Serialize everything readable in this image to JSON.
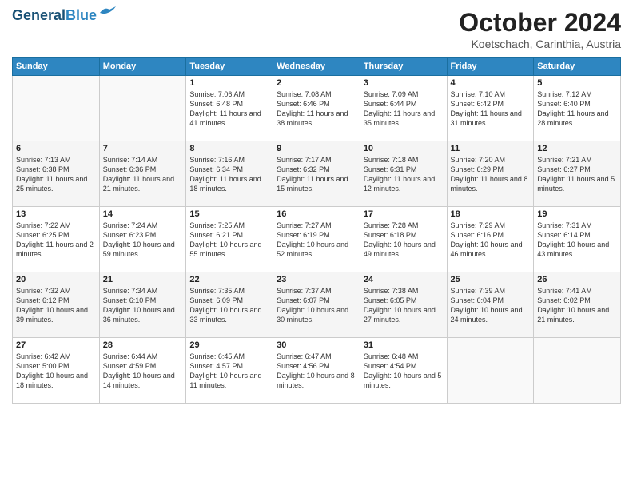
{
  "header": {
    "logo_line1": "General",
    "logo_line2": "Blue",
    "month_title": "October 2024",
    "location": "Koetschach, Carinthia, Austria"
  },
  "weekdays": [
    "Sunday",
    "Monday",
    "Tuesday",
    "Wednesday",
    "Thursday",
    "Friday",
    "Saturday"
  ],
  "weeks": [
    [
      {
        "day": "",
        "info": ""
      },
      {
        "day": "",
        "info": ""
      },
      {
        "day": "1",
        "info": "Sunrise: 7:06 AM\nSunset: 6:48 PM\nDaylight: 11 hours and 41 minutes."
      },
      {
        "day": "2",
        "info": "Sunrise: 7:08 AM\nSunset: 6:46 PM\nDaylight: 11 hours and 38 minutes."
      },
      {
        "day": "3",
        "info": "Sunrise: 7:09 AM\nSunset: 6:44 PM\nDaylight: 11 hours and 35 minutes."
      },
      {
        "day": "4",
        "info": "Sunrise: 7:10 AM\nSunset: 6:42 PM\nDaylight: 11 hours and 31 minutes."
      },
      {
        "day": "5",
        "info": "Sunrise: 7:12 AM\nSunset: 6:40 PM\nDaylight: 11 hours and 28 minutes."
      }
    ],
    [
      {
        "day": "6",
        "info": "Sunrise: 7:13 AM\nSunset: 6:38 PM\nDaylight: 11 hours and 25 minutes."
      },
      {
        "day": "7",
        "info": "Sunrise: 7:14 AM\nSunset: 6:36 PM\nDaylight: 11 hours and 21 minutes."
      },
      {
        "day": "8",
        "info": "Sunrise: 7:16 AM\nSunset: 6:34 PM\nDaylight: 11 hours and 18 minutes."
      },
      {
        "day": "9",
        "info": "Sunrise: 7:17 AM\nSunset: 6:32 PM\nDaylight: 11 hours and 15 minutes."
      },
      {
        "day": "10",
        "info": "Sunrise: 7:18 AM\nSunset: 6:31 PM\nDaylight: 11 hours and 12 minutes."
      },
      {
        "day": "11",
        "info": "Sunrise: 7:20 AM\nSunset: 6:29 PM\nDaylight: 11 hours and 8 minutes."
      },
      {
        "day": "12",
        "info": "Sunrise: 7:21 AM\nSunset: 6:27 PM\nDaylight: 11 hours and 5 minutes."
      }
    ],
    [
      {
        "day": "13",
        "info": "Sunrise: 7:22 AM\nSunset: 6:25 PM\nDaylight: 11 hours and 2 minutes."
      },
      {
        "day": "14",
        "info": "Sunrise: 7:24 AM\nSunset: 6:23 PM\nDaylight: 10 hours and 59 minutes."
      },
      {
        "day": "15",
        "info": "Sunrise: 7:25 AM\nSunset: 6:21 PM\nDaylight: 10 hours and 55 minutes."
      },
      {
        "day": "16",
        "info": "Sunrise: 7:27 AM\nSunset: 6:19 PM\nDaylight: 10 hours and 52 minutes."
      },
      {
        "day": "17",
        "info": "Sunrise: 7:28 AM\nSunset: 6:18 PM\nDaylight: 10 hours and 49 minutes."
      },
      {
        "day": "18",
        "info": "Sunrise: 7:29 AM\nSunset: 6:16 PM\nDaylight: 10 hours and 46 minutes."
      },
      {
        "day": "19",
        "info": "Sunrise: 7:31 AM\nSunset: 6:14 PM\nDaylight: 10 hours and 43 minutes."
      }
    ],
    [
      {
        "day": "20",
        "info": "Sunrise: 7:32 AM\nSunset: 6:12 PM\nDaylight: 10 hours and 39 minutes."
      },
      {
        "day": "21",
        "info": "Sunrise: 7:34 AM\nSunset: 6:10 PM\nDaylight: 10 hours and 36 minutes."
      },
      {
        "day": "22",
        "info": "Sunrise: 7:35 AM\nSunset: 6:09 PM\nDaylight: 10 hours and 33 minutes."
      },
      {
        "day": "23",
        "info": "Sunrise: 7:37 AM\nSunset: 6:07 PM\nDaylight: 10 hours and 30 minutes."
      },
      {
        "day": "24",
        "info": "Sunrise: 7:38 AM\nSunset: 6:05 PM\nDaylight: 10 hours and 27 minutes."
      },
      {
        "day": "25",
        "info": "Sunrise: 7:39 AM\nSunset: 6:04 PM\nDaylight: 10 hours and 24 minutes."
      },
      {
        "day": "26",
        "info": "Sunrise: 7:41 AM\nSunset: 6:02 PM\nDaylight: 10 hours and 21 minutes."
      }
    ],
    [
      {
        "day": "27",
        "info": "Sunrise: 6:42 AM\nSunset: 5:00 PM\nDaylight: 10 hours and 18 minutes."
      },
      {
        "day": "28",
        "info": "Sunrise: 6:44 AM\nSunset: 4:59 PM\nDaylight: 10 hours and 14 minutes."
      },
      {
        "day": "29",
        "info": "Sunrise: 6:45 AM\nSunset: 4:57 PM\nDaylight: 10 hours and 11 minutes."
      },
      {
        "day": "30",
        "info": "Sunrise: 6:47 AM\nSunset: 4:56 PM\nDaylight: 10 hours and 8 minutes."
      },
      {
        "day": "31",
        "info": "Sunrise: 6:48 AM\nSunset: 4:54 PM\nDaylight: 10 hours and 5 minutes."
      },
      {
        "day": "",
        "info": ""
      },
      {
        "day": "",
        "info": ""
      }
    ]
  ]
}
